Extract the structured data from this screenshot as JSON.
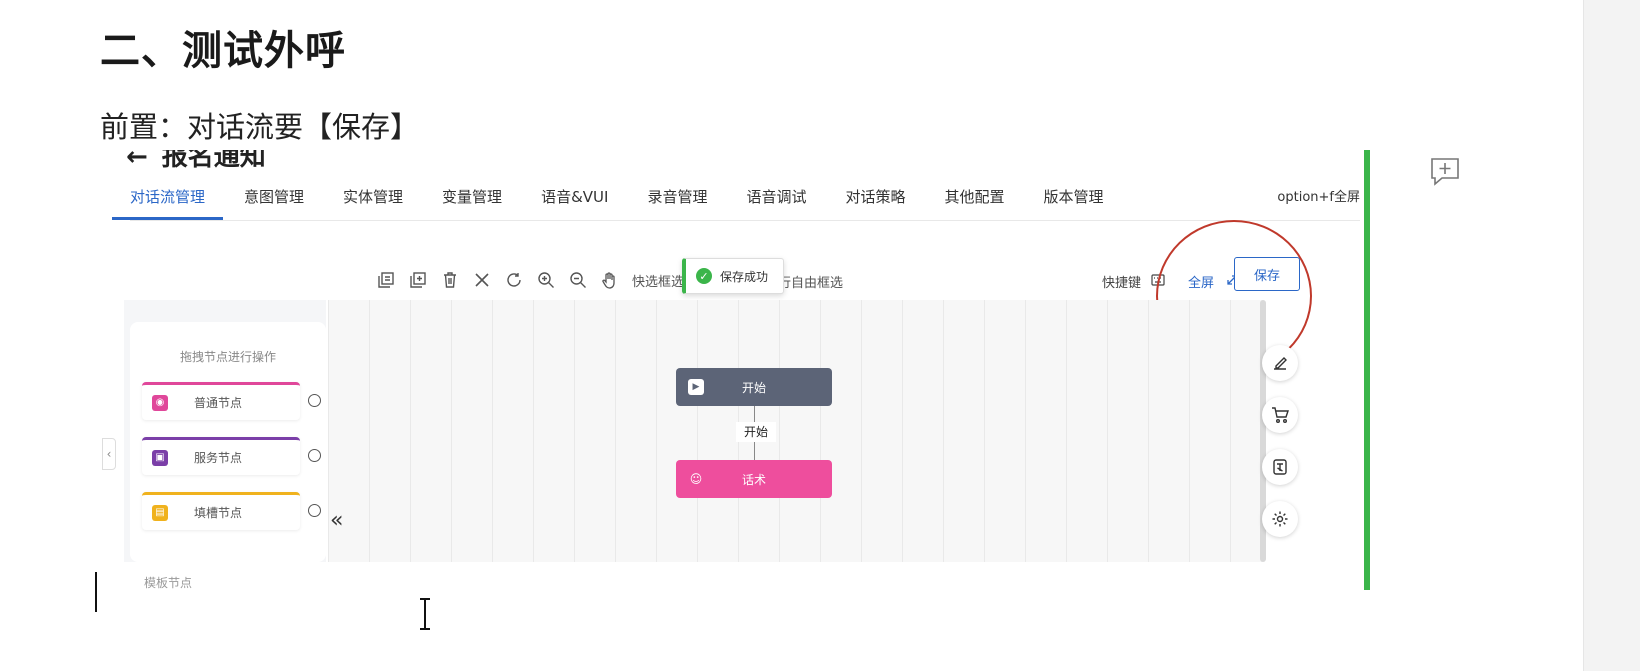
{
  "document": {
    "heading": "二、测试外呼",
    "paragraph": "前置：对话流要【保存】"
  },
  "app": {
    "title": "报名通知",
    "back_arrow": "←",
    "tabs": [
      {
        "label": "对话流管理",
        "active": true
      },
      {
        "label": "意图管理"
      },
      {
        "label": "实体管理"
      },
      {
        "label": "变量管理"
      },
      {
        "label": "语音&VUI"
      },
      {
        "label": "录音管理"
      },
      {
        "label": "语音调试"
      },
      {
        "label": "对话策略"
      },
      {
        "label": "其他配置"
      },
      {
        "label": "版本管理"
      }
    ],
    "shortcut_hint": "option+f全屏",
    "toolbar": {
      "icons": [
        "copy-icon",
        "paste-icon",
        "delete-icon",
        "close-icon",
        "refresh-icon",
        "zoom-in-icon",
        "zoom-out-icon",
        "hand-icon"
      ],
      "quick_select_label": "快选框选",
      "free_select_label": "行自由框选",
      "shortcut_key_label": "快捷键",
      "fullscreen_label": "全屏",
      "save_label": "保存"
    },
    "toast": {
      "text": "保存成功"
    },
    "left_panel": {
      "title": "拖拽节点进行操作",
      "nodes": [
        {
          "label": "普通节点",
          "color": "#e0479a"
        },
        {
          "label": "服务节点",
          "color": "#7b3fa8"
        },
        {
          "label": "填槽节点",
          "color": "#f0b21d"
        }
      ],
      "more_label": "模板节点"
    },
    "flow": {
      "start_label": "开始",
      "link_label": "开始",
      "script_label": "话术",
      "start_color": "#5c6477",
      "script_color": "#ee4e9d"
    },
    "float_tools": [
      "edit-icon",
      "cart-icon",
      "translate-icon",
      "settings-icon"
    ],
    "accent_color": "#2b67c7",
    "highlight_color": "#c0392b"
  }
}
